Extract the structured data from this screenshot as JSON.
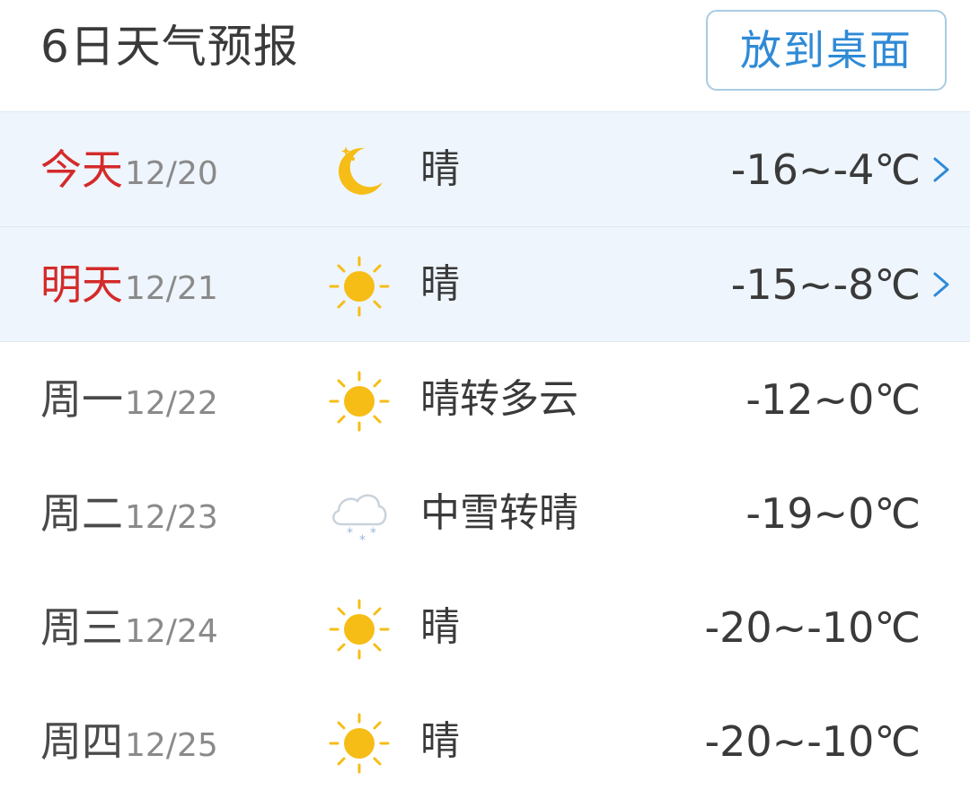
{
  "header": {
    "title": "6日天气预报",
    "desk_button": "放到桌面"
  },
  "forecast": [
    {
      "day": "今天",
      "date": "12/20",
      "icon": "moon-icon",
      "condition": "晴",
      "temp": "-16~-4℃",
      "highlight": true,
      "has_arrow": true
    },
    {
      "day": "明天",
      "date": "12/21",
      "icon": "sun-icon",
      "condition": "晴",
      "temp": "-15~-8℃",
      "highlight": true,
      "has_arrow": true
    },
    {
      "day": "周一",
      "date": "12/22",
      "icon": "sun-icon",
      "condition": "晴转多云",
      "temp": "-12~0℃",
      "highlight": false,
      "has_arrow": false
    },
    {
      "day": "周二",
      "date": "12/23",
      "icon": "snow-cloud-icon",
      "condition": "中雪转晴",
      "temp": "-19~0℃",
      "highlight": false,
      "has_arrow": false
    },
    {
      "day": "周三",
      "date": "12/24",
      "icon": "sun-icon",
      "condition": "晴",
      "temp": "-20~-10℃",
      "highlight": false,
      "has_arrow": false
    },
    {
      "day": "周四",
      "date": "12/25",
      "icon": "sun-icon",
      "condition": "晴",
      "temp": "-20~-10℃",
      "highlight": false,
      "has_arrow": false
    }
  ],
  "colors": {
    "accent": "#2f8ad6",
    "today_red": "#d42a2a",
    "highlight_bg": "#eef5fc",
    "sun": "#f6bd16"
  }
}
